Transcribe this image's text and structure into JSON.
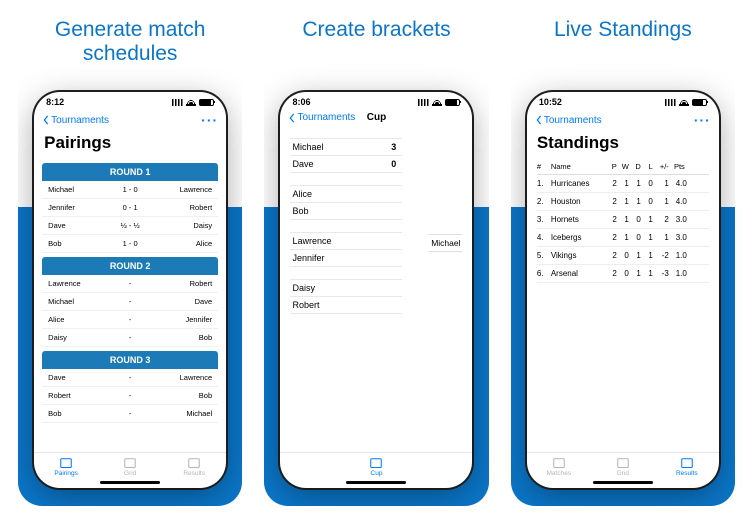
{
  "colors": {
    "accent": "#0b76c9",
    "ios_blue": "#007aff"
  },
  "panel1": {
    "caption": "Generate match schedules",
    "time": "8:12",
    "back": "Tournaments",
    "title": "Pairings",
    "rounds": [
      {
        "name": "ROUND 1",
        "matches": [
          {
            "p1": "Michael",
            "score": "1 - 0",
            "p2": "Lawrence"
          },
          {
            "p1": "Jennifer",
            "score": "0 - 1",
            "p2": "Robert"
          },
          {
            "p1": "Dave",
            "score": "½ - ½",
            "p2": "Daisy"
          },
          {
            "p1": "Bob",
            "score": "1 - 0",
            "p2": "Alice"
          }
        ]
      },
      {
        "name": "ROUND 2",
        "matches": [
          {
            "p1": "Lawrence",
            "score": "-",
            "p2": "Robert"
          },
          {
            "p1": "Michael",
            "score": "-",
            "p2": "Dave"
          },
          {
            "p1": "Alice",
            "score": "-",
            "p2": "Jennifer"
          },
          {
            "p1": "Daisy",
            "score": "-",
            "p2": "Bob"
          }
        ]
      },
      {
        "name": "ROUND 3",
        "matches": [
          {
            "p1": "Dave",
            "score": "-",
            "p2": "Lawrence"
          },
          {
            "p1": "Robert",
            "score": "-",
            "p2": "Bob"
          },
          {
            "p1": "Bob",
            "score": "-",
            "p2": "Michael"
          }
        ]
      }
    ],
    "tabs": [
      {
        "label": "Pairings",
        "active": true
      },
      {
        "label": "Grid",
        "active": false
      },
      {
        "label": "Results",
        "active": false
      }
    ]
  },
  "panel2": {
    "caption": "Create brackets",
    "time": "8:06",
    "back": "Tournaments",
    "nav_title": "Cup",
    "matches": [
      {
        "p1": "Michael",
        "s1": "3",
        "p2": "Dave",
        "s2": "0"
      },
      {
        "p1": "Alice",
        "s1": "",
        "p2": "Bob",
        "s2": ""
      },
      {
        "p1": "Lawrence",
        "s1": "",
        "p2": "Jennifer",
        "s2": ""
      },
      {
        "p1": "Daisy",
        "s1": "",
        "p2": "Robert",
        "s2": ""
      }
    ],
    "next_round_winner": "Michael",
    "tabs": [
      {
        "label": "Cup",
        "active": true
      }
    ]
  },
  "panel3": {
    "caption": "Live Standings",
    "time": "10:52",
    "back": "Tournaments",
    "title": "Standings",
    "columns": [
      "#",
      "Name",
      "P",
      "W",
      "D",
      "L",
      "+/-",
      "Pts"
    ],
    "rows": [
      {
        "rank": "1.",
        "name": "Hurricanes",
        "p": "2",
        "w": "1",
        "d": "1",
        "l": "0",
        "gd": "1",
        "pts": "4.0"
      },
      {
        "rank": "2.",
        "name": "Houston",
        "p": "2",
        "w": "1",
        "d": "1",
        "l": "0",
        "gd": "1",
        "pts": "4.0"
      },
      {
        "rank": "3.",
        "name": "Hornets",
        "p": "2",
        "w": "1",
        "d": "0",
        "l": "1",
        "gd": "2",
        "pts": "3.0"
      },
      {
        "rank": "4.",
        "name": "Icebergs",
        "p": "2",
        "w": "1",
        "d": "0",
        "l": "1",
        "gd": "1",
        "pts": "3.0"
      },
      {
        "rank": "5.",
        "name": "Vikings",
        "p": "2",
        "w": "0",
        "d": "1",
        "l": "1",
        "gd": "-2",
        "pts": "1.0"
      },
      {
        "rank": "6.",
        "name": "Arsenal",
        "p": "2",
        "w": "0",
        "d": "1",
        "l": "1",
        "gd": "-3",
        "pts": "1.0"
      }
    ],
    "tabs": [
      {
        "label": "Matches",
        "active": false
      },
      {
        "label": "Grid",
        "active": false
      },
      {
        "label": "Results",
        "active": true
      }
    ]
  }
}
